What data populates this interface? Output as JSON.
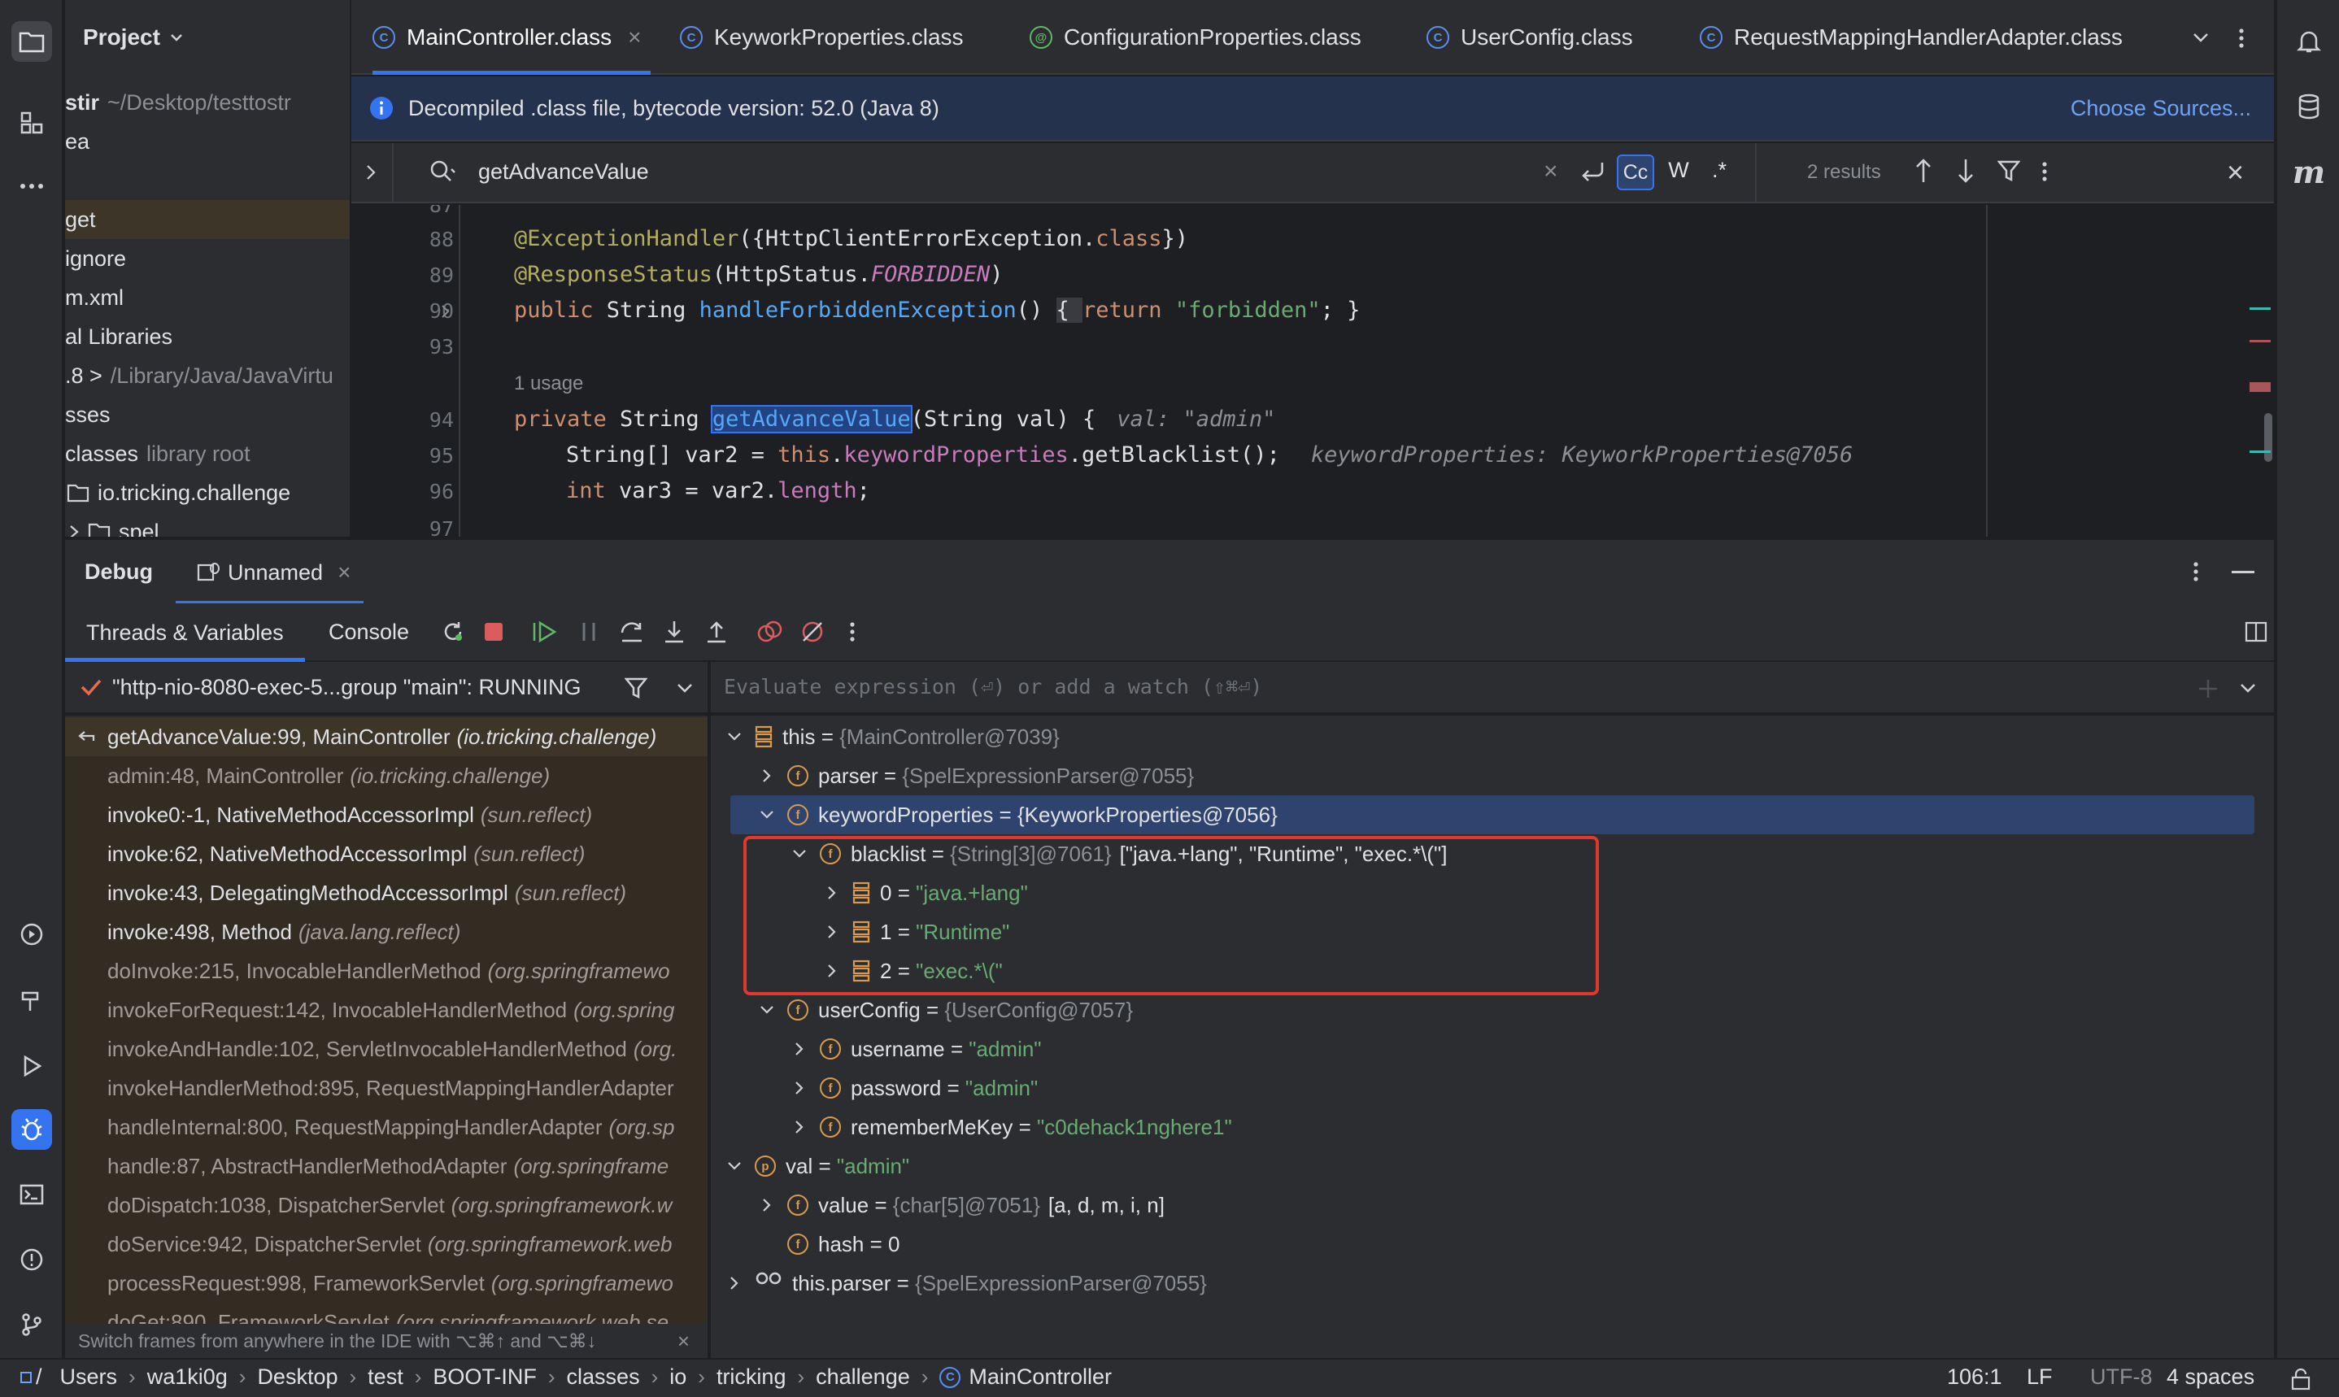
{
  "project_panel": {
    "title": "Project",
    "items": [
      {
        "label": "stir",
        "muted": "~/Desktop/testtostr"
      },
      {
        "label": "ea",
        "muted": ""
      },
      {
        "label": "",
        "muted": ""
      },
      {
        "label": "get",
        "muted": ""
      },
      {
        "label": "ignore",
        "muted": ""
      },
      {
        "label": "m.xml",
        "muted": ""
      },
      {
        "label": "al Libraries",
        "muted": ""
      },
      {
        "label": ".8 >",
        "muted": "/Library/Java/JavaVirtu"
      },
      {
        "label": "sses",
        "muted": ""
      },
      {
        "label": "classes",
        "muted": "library root"
      },
      {
        "label": "io.tricking.challenge",
        "muted": ""
      },
      {
        "label": "spel",
        "muted": ""
      }
    ]
  },
  "editor_tabs": [
    {
      "label": "MainController.class",
      "active": true
    },
    {
      "label": "KeyworkProperties.class",
      "active": false
    },
    {
      "label": "ConfigurationProperties.class",
      "active": false
    },
    {
      "label": "UserConfig.class",
      "active": false
    },
    {
      "label": "RequestMappingHandlerAdapter.class",
      "active": false
    }
  ],
  "banner": {
    "text": "Decompiled .class file, bytecode version: 52.0 (Java 8)",
    "action": "Choose Sources..."
  },
  "search": {
    "query": "getAdvanceValue",
    "results": "2 results",
    "opt_case": "Cc",
    "opt_word": "W",
    "opt_regex": ".*"
  },
  "code": {
    "lines": [
      {
        "num": "87"
      },
      {
        "num": "88",
        "ann": "@ExceptionHandler",
        "rest1": "({HttpClientErrorException.",
        "kw": "class",
        "rest2": "})"
      },
      {
        "num": "89",
        "ann": "@ResponseStatus",
        "rest1": "(HttpStatus.",
        "stat": "FORBIDDEN",
        "rest2": ")"
      },
      {
        "num": "90",
        "kw": "public",
        "type": " String ",
        "fn": "handleForbiddenException",
        "rest": "() ",
        "ret": "{ ",
        "kw2": "return",
        "str": " \"forbidden\"",
        "end": "; }"
      },
      {
        "num": "93"
      },
      {
        "usage": "1 usage"
      },
      {
        "num": "94",
        "kw": "private",
        "type": " String ",
        "fn": "getAdvanceValue",
        "rest": "(String val) {",
        "hint": "val: \"admin\""
      },
      {
        "num": "95",
        "text1": "String[] var2 = ",
        "kw": "this",
        "dot": ".",
        "fld": "keywordProperties",
        "text2": ".getBlacklist();",
        "hint": "keywordProperties: KeyworkProperties@7056"
      },
      {
        "num": "96",
        "kw": "int",
        "text": " var3 = var2.",
        "fld": "length",
        "end": ";"
      },
      {
        "num": "97"
      }
    ]
  },
  "debug": {
    "title": "Debug",
    "session": "Unnamed",
    "tab_threads": "Threads & Variables",
    "tab_console": "Console",
    "thread": "\"http-nio-8080-exec-5...group \"main\": RUNNING",
    "eval_placeholder": "Evaluate expression (⏎) or add a watch (⇧⌘⏎)",
    "frames": [
      {
        "method": "getAdvanceValue:99, MainController",
        "pkg": "(io.tricking.challenge)",
        "current": true
      },
      {
        "method": "admin:48, MainController",
        "pkg": "(io.tricking.challenge)",
        "dim": true
      },
      {
        "method": "invoke0:-1, NativeMethodAccessorImpl",
        "pkg": "(sun.reflect)"
      },
      {
        "method": "invoke:62, NativeMethodAccessorImpl",
        "pkg": "(sun.reflect)"
      },
      {
        "method": "invoke:43, DelegatingMethodAccessorImpl",
        "pkg": "(sun.reflect)"
      },
      {
        "method": "invoke:498, Method",
        "pkg": "(java.lang.reflect)"
      },
      {
        "method": "doInvoke:215, InvocableHandlerMethod",
        "pkg": "(org.springframewo",
        "dim": true
      },
      {
        "method": "invokeForRequest:142, InvocableHandlerMethod",
        "pkg": "(org.spring",
        "dim": true
      },
      {
        "method": "invokeAndHandle:102, ServletInvocableHandlerMethod",
        "pkg": "(org.",
        "dim": true
      },
      {
        "method": "invokeHandlerMethod:895, RequestMappingHandlerAdapter",
        "pkg": "",
        "dim": true
      },
      {
        "method": "handleInternal:800, RequestMappingHandlerAdapter",
        "pkg": "(org.sp",
        "dim": true
      },
      {
        "method": "handle:87, AbstractHandlerMethodAdapter",
        "pkg": "(org.springframe",
        "dim": true
      },
      {
        "method": "doDispatch:1038, DispatcherServlet",
        "pkg": "(org.springframework.w",
        "dim": true
      },
      {
        "method": "doService:942, DispatcherServlet",
        "pkg": "(org.springframework.web",
        "dim": true
      },
      {
        "method": "processRequest:998, FrameworkServlet",
        "pkg": "(org.springframewo",
        "dim": true
      },
      {
        "method": "doGet:890, FrameworkServlet",
        "pkg": "(org.springframework.web.se",
        "dim": true
      }
    ],
    "frames_hint": "Switch frames from anywhere in the IDE with ⌥⌘↑ and ⌥⌘↓",
    "variables": [
      {
        "indent": 0,
        "chev": "down",
        "icon": "stack",
        "name": "this",
        "ref": "{MainController@7039}",
        "val": ""
      },
      {
        "indent": 1,
        "chev": "right",
        "icon": "f",
        "name": "parser",
        "ref": "{SpelExpressionParser@7055}",
        "val": ""
      },
      {
        "indent": 1,
        "chev": "down",
        "icon": "f",
        "name": "keywordProperties",
        "ref": "{KeyworkProperties@7056}",
        "val": "",
        "selected": true
      },
      {
        "indent": 2,
        "chev": "down",
        "icon": "f",
        "name": "blacklist",
        "ref": "{String[3]@7061}",
        "val": "[\"java.+lang\", \"Runtime\", \"exec.*\\(\"]"
      },
      {
        "indent": 3,
        "chev": "right",
        "icon": "stack",
        "name": "0",
        "ref": "",
        "str": "\"java.+lang\""
      },
      {
        "indent": 3,
        "chev": "right",
        "icon": "stack",
        "name": "1",
        "ref": "",
        "str": "\"Runtime\""
      },
      {
        "indent": 3,
        "chev": "right",
        "icon": "stack",
        "name": "2",
        "ref": "",
        "str": "\"exec.*\\(\""
      },
      {
        "indent": 1,
        "chev": "down",
        "icon": "f",
        "name": "userConfig",
        "ref": "{UserConfig@7057}",
        "val": ""
      },
      {
        "indent": 2,
        "chev": "right",
        "icon": "f",
        "name": "username",
        "ref": "",
        "str": "\"admin\""
      },
      {
        "indent": 2,
        "chev": "right",
        "icon": "f",
        "name": "password",
        "ref": "",
        "str": "\"admin\""
      },
      {
        "indent": 2,
        "chev": "right",
        "icon": "f",
        "name": "rememberMeKey",
        "ref": "",
        "str": "\"c0dehack1nghere1\""
      },
      {
        "indent": 0,
        "chev": "down",
        "icon": "p",
        "name": "val",
        "ref": "",
        "str": "\"admin\""
      },
      {
        "indent": 1,
        "chev": "right",
        "icon": "f",
        "name": "value",
        "ref": "{char[5]@7051}",
        "val": "[a, d, m, i, n]"
      },
      {
        "indent": 1,
        "chev": "none",
        "icon": "f",
        "name": "hash",
        "ref": "",
        "val": "0"
      },
      {
        "indent": 0,
        "chev": "right",
        "icon": "watch",
        "name": "this.parser",
        "ref": "{SpelExpressionParser@7055}",
        "val": ""
      }
    ]
  },
  "statusbar": {
    "crumbs": [
      "/",
      "Users",
      "wa1ki0g",
      "Desktop",
      "test",
      "BOOT-INF",
      "classes",
      "io",
      "tricking",
      "challenge",
      "MainController"
    ],
    "position": "106:1",
    "line_sep": "LF",
    "encoding": "UTF-8",
    "indent": "4 spaces"
  },
  "colors": {
    "accent": "#3574f0",
    "highlight_box": "#e0382e",
    "selected_row": "#2e436e"
  }
}
